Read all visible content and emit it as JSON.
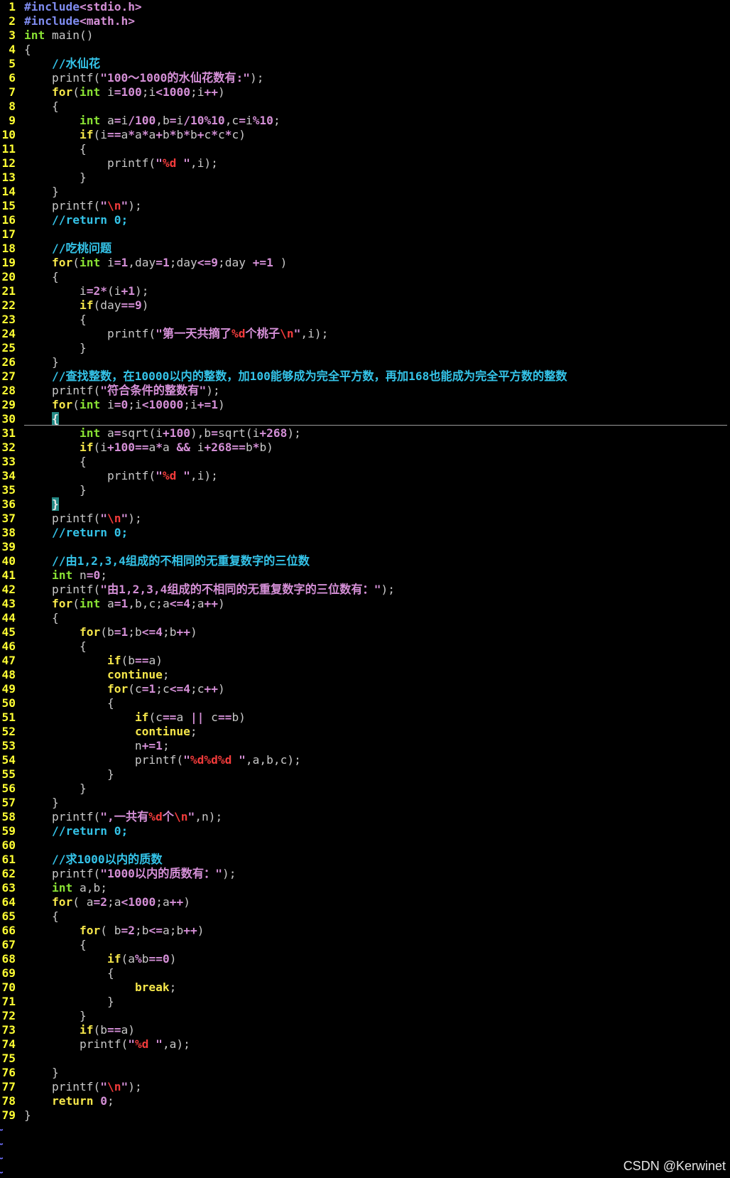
{
  "theme": {
    "background": "#000000",
    "text": "#c8c8c8",
    "line_number": "#ffff33",
    "cursorline": "#9a9a9a",
    "eof_marker": "#6f6fff"
  },
  "editor": {
    "lines": [
      {
        "n": "1",
        "t": [
          [
            "#7f8cf0",
            "#include"
          ],
          [
            "#d48fd6",
            "<stdio.h>"
          ]
        ]
      },
      {
        "n": "2",
        "t": [
          [
            "#7f8cf0",
            "#include"
          ],
          [
            "#d48fd6",
            "<math.h>"
          ]
        ]
      },
      {
        "n": "3",
        "t": [
          [
            "#8ae234",
            "int"
          ],
          " main()"
        ]
      },
      {
        "n": "4",
        "t": [
          "{"
        ]
      },
      {
        "n": "5",
        "t": [
          "    ",
          [
            "#34c3e8",
            "//水仙花"
          ]
        ]
      },
      {
        "n": "6",
        "t": [
          "    printf(",
          [
            "#d48fd6",
            "\"100～1000的水仙花数有:\""
          ],
          ");"
        ]
      },
      {
        "n": "7",
        "t": [
          "    ",
          [
            "#f5e64a",
            "for"
          ],
          "(",
          [
            "#8ae234",
            "int"
          ],
          " i",
          [
            "#d48fd6",
            "=100"
          ],
          ";i",
          [
            "#d48fd6",
            "<1000"
          ],
          ";i",
          [
            "#d48fd6",
            "++"
          ],
          ")"
        ]
      },
      {
        "n": "8",
        "t": [
          "    {"
        ]
      },
      {
        "n": "9",
        "t": [
          "        ",
          [
            "#8ae234",
            "int"
          ],
          " a",
          [
            "#d48fd6",
            "="
          ],
          "i",
          [
            "#d48fd6",
            "/100"
          ],
          ",b",
          [
            "#d48fd6",
            "="
          ],
          "i",
          [
            "#d48fd6",
            "/10%10"
          ],
          ",c",
          [
            "#d48fd6",
            "="
          ],
          "i",
          [
            "#d48fd6",
            "%10"
          ],
          ";"
        ]
      },
      {
        "n": "10",
        "t": [
          "        ",
          [
            "#f5e64a",
            "if"
          ],
          "(i",
          [
            "#d48fd6",
            "=="
          ],
          "a",
          [
            "#d48fd6",
            "*"
          ],
          "a",
          [
            "#d48fd6",
            "*"
          ],
          "a",
          [
            "#d48fd6",
            "+"
          ],
          "b",
          [
            "#d48fd6",
            "*"
          ],
          "b",
          [
            "#d48fd6",
            "*"
          ],
          "b",
          [
            "#d48fd6",
            "+"
          ],
          "c",
          [
            "#d48fd6",
            "*"
          ],
          "c",
          [
            "#d48fd6",
            "*"
          ],
          "c)"
        ]
      },
      {
        "n": "11",
        "t": [
          "        {"
        ]
      },
      {
        "n": "12",
        "t": [
          "            printf(",
          [
            "#d48fd6",
            "\""
          ],
          [
            "#f23b3b",
            "%d"
          ],
          [
            "#d48fd6",
            " \""
          ],
          ",i);"
        ]
      },
      {
        "n": "13",
        "t": [
          "        }"
        ]
      },
      {
        "n": "14",
        "t": [
          "    }"
        ]
      },
      {
        "n": "15",
        "t": [
          "    printf(",
          [
            "#d48fd6",
            "\""
          ],
          [
            "#f23b3b",
            "\\n"
          ],
          [
            "#d48fd6",
            "\""
          ],
          ");"
        ]
      },
      {
        "n": "16",
        "t": [
          "    ",
          [
            "#34c3e8",
            "//return 0;"
          ]
        ]
      },
      {
        "n": "17",
        "t": []
      },
      {
        "n": "18",
        "t": [
          "    ",
          [
            "#34c3e8",
            "//吃桃问题"
          ]
        ]
      },
      {
        "n": "19",
        "t": [
          "    ",
          [
            "#f5e64a",
            "for"
          ],
          "(",
          [
            "#8ae234",
            "int"
          ],
          " i",
          [
            "#d48fd6",
            "=1"
          ],
          ",day",
          [
            "#d48fd6",
            "=1"
          ],
          ";day",
          [
            "#d48fd6",
            "<=9"
          ],
          ";day ",
          [
            "#d48fd6",
            "+=1"
          ],
          " )"
        ]
      },
      {
        "n": "20",
        "t": [
          "    {"
        ]
      },
      {
        "n": "21",
        "t": [
          "        i",
          [
            "#d48fd6",
            "=2*"
          ],
          "(i",
          [
            "#d48fd6",
            "+1"
          ],
          ");"
        ]
      },
      {
        "n": "22",
        "t": [
          "        ",
          [
            "#f5e64a",
            "if"
          ],
          "(day",
          [
            "#d48fd6",
            "==9"
          ],
          ")"
        ]
      },
      {
        "n": "23",
        "t": [
          "        {"
        ]
      },
      {
        "n": "24",
        "t": [
          "            printf(",
          [
            "#d48fd6",
            "\"第一天共摘了"
          ],
          [
            "#f23b3b",
            "%d"
          ],
          [
            "#d48fd6",
            "个桃子"
          ],
          [
            "#f23b3b",
            "\\n"
          ],
          [
            "#d48fd6",
            "\""
          ],
          ",i);"
        ]
      },
      {
        "n": "25",
        "t": [
          "        }"
        ]
      },
      {
        "n": "26",
        "t": [
          "    }"
        ]
      },
      {
        "n": "27",
        "t": [
          "    ",
          [
            "#34c3e8",
            "//查找整数，在10000以内的整数，加100能够成为完全平方数，再加168也能成为完全平方数的整数"
          ]
        ]
      },
      {
        "n": "28",
        "t": [
          "    printf(",
          [
            "#d48fd6",
            "\"符合条件的整数有\""
          ],
          ");"
        ]
      },
      {
        "n": "29",
        "t": [
          "    ",
          [
            "#f5e64a",
            "for"
          ],
          "(",
          [
            "#8ae234",
            "int"
          ],
          " i",
          [
            "#d48fd6",
            "=0"
          ],
          ";i",
          [
            "#d48fd6",
            "<10000"
          ],
          ";i",
          [
            "#d48fd6",
            "+=1"
          ],
          ")"
        ]
      },
      {
        "n": "30",
        "cur": true,
        "t": [
          "    ",
          [
            "#e6e6e6",
            "{",
            "#258a86"
          ]
        ]
      },
      {
        "n": "31",
        "t": [
          "        ",
          [
            "#8ae234",
            "int"
          ],
          " a",
          [
            "#d48fd6",
            "="
          ],
          "sqrt(i",
          [
            "#d48fd6",
            "+100"
          ],
          "),b",
          [
            "#d48fd6",
            "="
          ],
          "sqrt(i",
          [
            "#d48fd6",
            "+268"
          ],
          ");"
        ]
      },
      {
        "n": "32",
        "t": [
          "        ",
          [
            "#f5e64a",
            "if"
          ],
          "(i",
          [
            "#d48fd6",
            "+100=="
          ],
          "a",
          [
            "#d48fd6",
            "*"
          ],
          "a ",
          [
            "#d48fd6",
            "&&"
          ],
          " i",
          [
            "#d48fd6",
            "+268=="
          ],
          "b",
          [
            "#d48fd6",
            "*"
          ],
          "b)"
        ]
      },
      {
        "n": "33",
        "t": [
          "        {"
        ]
      },
      {
        "n": "34",
        "t": [
          "            printf(",
          [
            "#d48fd6",
            "\""
          ],
          [
            "#f23b3b",
            "%d"
          ],
          [
            "#d48fd6",
            " \""
          ],
          ",i);"
        ]
      },
      {
        "n": "35",
        "t": [
          "        }"
        ]
      },
      {
        "n": "36",
        "t": [
          "    ",
          [
            "#e6e6e6",
            "}",
            "#258a86"
          ]
        ]
      },
      {
        "n": "37",
        "t": [
          "    printf(",
          [
            "#d48fd6",
            "\""
          ],
          [
            "#f23b3b",
            "\\n"
          ],
          [
            "#d48fd6",
            "\""
          ],
          ");"
        ]
      },
      {
        "n": "38",
        "t": [
          "    ",
          [
            "#34c3e8",
            "//return 0;"
          ]
        ]
      },
      {
        "n": "39",
        "t": []
      },
      {
        "n": "40",
        "t": [
          "    ",
          [
            "#34c3e8",
            "//由1,2,3,4组成的不相同的无重复数字的三位数"
          ]
        ]
      },
      {
        "n": "41",
        "t": [
          "    ",
          [
            "#8ae234",
            "int"
          ],
          " n",
          [
            "#d48fd6",
            "=0"
          ],
          ";"
        ]
      },
      {
        "n": "42",
        "t": [
          "    printf(",
          [
            "#d48fd6",
            "\"由1,2,3,4组成的不相同的无重复数字的三位数有：\""
          ],
          ");"
        ]
      },
      {
        "n": "43",
        "t": [
          "    ",
          [
            "#f5e64a",
            "for"
          ],
          "(",
          [
            "#8ae234",
            "int"
          ],
          " a",
          [
            "#d48fd6",
            "=1"
          ],
          ",b,c;a",
          [
            "#d48fd6",
            "<=4"
          ],
          ";a",
          [
            "#d48fd6",
            "++"
          ],
          ")"
        ]
      },
      {
        "n": "44",
        "t": [
          "    {"
        ]
      },
      {
        "n": "45",
        "t": [
          "        ",
          [
            "#f5e64a",
            "for"
          ],
          "(b",
          [
            "#d48fd6",
            "=1"
          ],
          ";b",
          [
            "#d48fd6",
            "<=4"
          ],
          ";b",
          [
            "#d48fd6",
            "++"
          ],
          ")"
        ]
      },
      {
        "n": "46",
        "t": [
          "        {"
        ]
      },
      {
        "n": "47",
        "t": [
          "            ",
          [
            "#f5e64a",
            "if"
          ],
          "(b",
          [
            "#d48fd6",
            "=="
          ],
          "a)"
        ]
      },
      {
        "n": "48",
        "t": [
          "            ",
          [
            "#f5e64a",
            "continue"
          ],
          ";"
        ]
      },
      {
        "n": "49",
        "t": [
          "            ",
          [
            "#f5e64a",
            "for"
          ],
          "(c",
          [
            "#d48fd6",
            "=1"
          ],
          ";c",
          [
            "#d48fd6",
            "<=4"
          ],
          ";c",
          [
            "#d48fd6",
            "++"
          ],
          ")"
        ]
      },
      {
        "n": "50",
        "t": [
          "            {"
        ]
      },
      {
        "n": "51",
        "t": [
          "                ",
          [
            "#f5e64a",
            "if"
          ],
          "(c",
          [
            "#d48fd6",
            "=="
          ],
          "a ",
          [
            "#d48fd6",
            "||"
          ],
          " c",
          [
            "#d48fd6",
            "=="
          ],
          "b)"
        ]
      },
      {
        "n": "52",
        "t": [
          "                ",
          [
            "#f5e64a",
            "continue"
          ],
          ";"
        ]
      },
      {
        "n": "53",
        "t": [
          "                n",
          [
            "#d48fd6",
            "+=1"
          ],
          ";"
        ]
      },
      {
        "n": "54",
        "t": [
          "                printf(",
          [
            "#d48fd6",
            "\""
          ],
          [
            "#f23b3b",
            "%d%d%d"
          ],
          [
            "#d48fd6",
            " \""
          ],
          ",a,b,c);"
        ]
      },
      {
        "n": "55",
        "t": [
          "            }"
        ]
      },
      {
        "n": "56",
        "t": [
          "        }"
        ]
      },
      {
        "n": "57",
        "t": [
          "    }"
        ]
      },
      {
        "n": "58",
        "t": [
          "    printf(",
          [
            "#d48fd6",
            "\",一共有"
          ],
          [
            "#f23b3b",
            "%d"
          ],
          [
            "#d48fd6",
            "个"
          ],
          [
            "#f23b3b",
            "\\n"
          ],
          [
            "#d48fd6",
            "\""
          ],
          ",n);"
        ]
      },
      {
        "n": "59",
        "t": [
          "    ",
          [
            "#34c3e8",
            "//return 0;"
          ]
        ]
      },
      {
        "n": "60",
        "t": []
      },
      {
        "n": "61",
        "t": [
          "    ",
          [
            "#34c3e8",
            "//求1000以内的质数"
          ]
        ]
      },
      {
        "n": "62",
        "t": [
          "    printf(",
          [
            "#d48fd6",
            "\"1000以内的质数有：\""
          ],
          ");"
        ]
      },
      {
        "n": "63",
        "t": [
          "    ",
          [
            "#8ae234",
            "int"
          ],
          " a,b;"
        ]
      },
      {
        "n": "64",
        "t": [
          "    ",
          [
            "#f5e64a",
            "for"
          ],
          "( a",
          [
            "#d48fd6",
            "=2"
          ],
          ";a",
          [
            "#d48fd6",
            "<1000"
          ],
          ";a",
          [
            "#d48fd6",
            "++"
          ],
          ")"
        ]
      },
      {
        "n": "65",
        "t": [
          "    {"
        ]
      },
      {
        "n": "66",
        "t": [
          "        ",
          [
            "#f5e64a",
            "for"
          ],
          "( b",
          [
            "#d48fd6",
            "=2"
          ],
          ";b",
          [
            "#d48fd6",
            "<="
          ],
          "a;b",
          [
            "#d48fd6",
            "++"
          ],
          ")"
        ]
      },
      {
        "n": "67",
        "t": [
          "        {"
        ]
      },
      {
        "n": "68",
        "t": [
          "            ",
          [
            "#f5e64a",
            "if"
          ],
          "(a",
          [
            "#d48fd6",
            "%"
          ],
          "b",
          [
            "#d48fd6",
            "==0"
          ],
          ")"
        ]
      },
      {
        "n": "69",
        "t": [
          "            {"
        ]
      },
      {
        "n": "70",
        "t": [
          "                ",
          [
            "#f5e64a",
            "break"
          ],
          ";"
        ]
      },
      {
        "n": "71",
        "t": [
          "            }"
        ]
      },
      {
        "n": "72",
        "t": [
          "        }"
        ]
      },
      {
        "n": "73",
        "t": [
          "        ",
          [
            "#f5e64a",
            "if"
          ],
          "(b",
          [
            "#d48fd6",
            "=="
          ],
          "a)"
        ]
      },
      {
        "n": "74",
        "t": [
          "        printf(",
          [
            "#d48fd6",
            "\""
          ],
          [
            "#f23b3b",
            "%d"
          ],
          [
            "#d48fd6",
            " \""
          ],
          ",a);"
        ]
      },
      {
        "n": "75",
        "t": []
      },
      {
        "n": "76",
        "t": [
          "    }"
        ]
      },
      {
        "n": "77",
        "t": [
          "    printf(",
          [
            "#d48fd6",
            "\""
          ],
          [
            "#f23b3b",
            "\\n"
          ],
          [
            "#d48fd6",
            "\""
          ],
          ");"
        ]
      },
      {
        "n": "78",
        "t": [
          "    ",
          [
            "#f5e64a",
            "return"
          ],
          " ",
          [
            "#d48fd6",
            "0"
          ],
          ";"
        ]
      },
      {
        "n": "79",
        "t": [
          "}"
        ]
      }
    ],
    "eof_markers": [
      "~",
      "~",
      "~",
      "~"
    ]
  },
  "watermark": "CSDN @Kerwinet"
}
